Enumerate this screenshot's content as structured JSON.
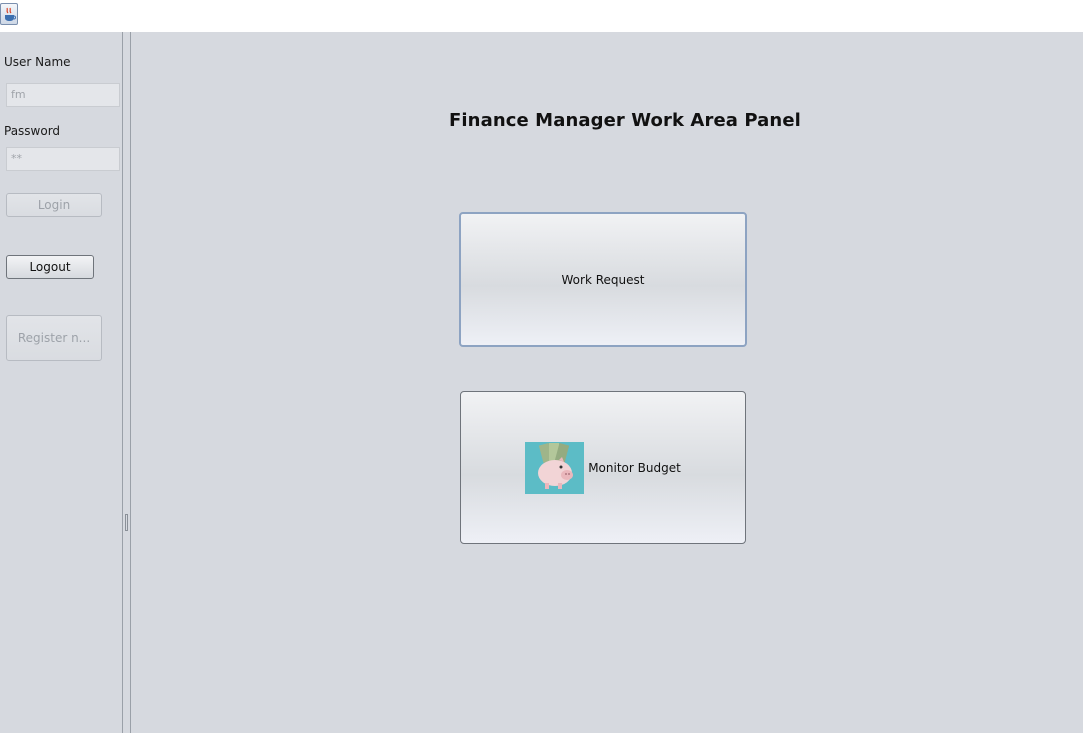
{
  "window": {
    "icon": "java-coffee-cup-icon"
  },
  "login": {
    "username_label": "User Name",
    "username_value": "fm",
    "password_label": "Password",
    "password_value": "**",
    "login_button": "Login",
    "logout_button": "Logout",
    "register_button": "Register n..."
  },
  "main": {
    "title": "Finance Manager Work Area Panel",
    "work_request_button": "Work Request",
    "monitor_budget_button": "Monitor Budget",
    "monitor_budget_icon": "piggy-bank-icon"
  },
  "colors": {
    "background": "#d6d9df",
    "focus_border": "#8da3c2"
  }
}
